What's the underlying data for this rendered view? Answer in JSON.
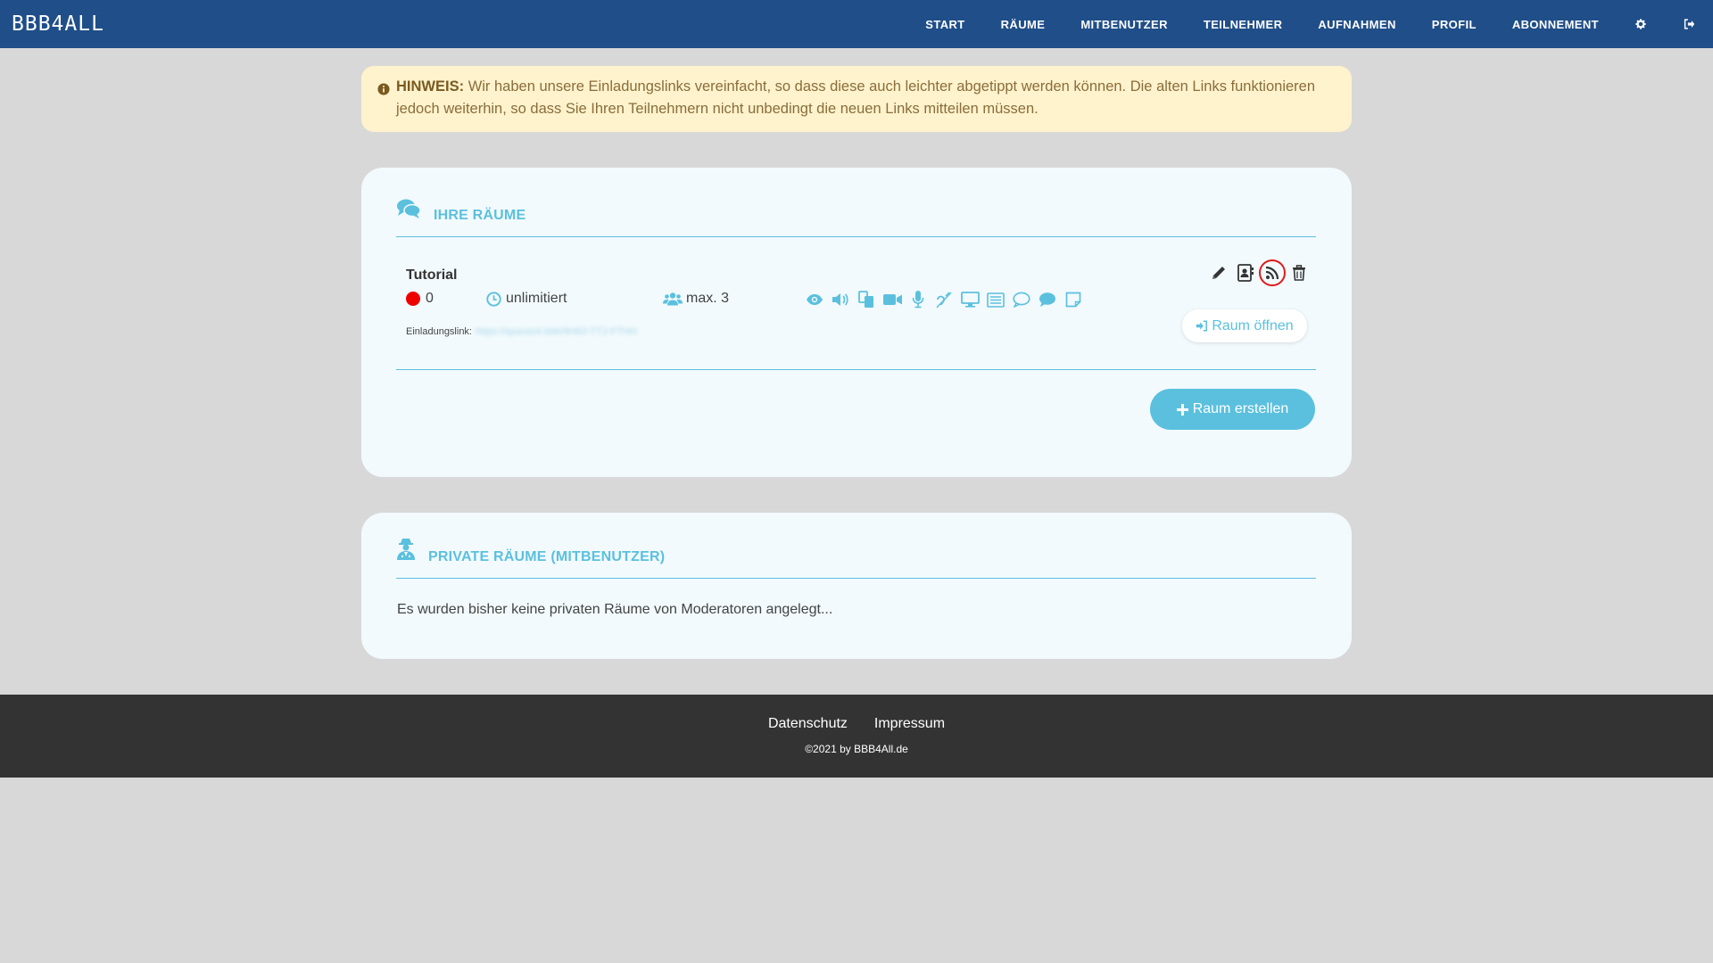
{
  "app": {
    "logo": "BBB4ALL"
  },
  "nav": {
    "items": [
      {
        "label": "START"
      },
      {
        "label": "RÄUME"
      },
      {
        "label": "MITBENUTZER"
      },
      {
        "label": "TEILNEHMER"
      },
      {
        "label": "AUFNAHMEN"
      },
      {
        "label": "PROFIL"
      },
      {
        "label": "ABONNEMENT"
      }
    ],
    "icons": [
      "gear-icon",
      "logout-icon"
    ]
  },
  "alert": {
    "icon": "info-circle-icon",
    "label": "HINWEIS:",
    "text": "Wir haben unsere Einladungslinks vereinfacht, so dass diese auch leichter abgetippt werden können. Die alten Links funktionieren jedoch weiterhin, so dass Sie Ihren Teilnehmern nicht unbedingt die neuen Links mitteilen müssen."
  },
  "my_rooms": {
    "title": "IHRE RÄUME",
    "icon": "comments-icon",
    "rooms": [
      {
        "name": "Tutorial",
        "online_count": "0",
        "duration": "unlimitiert",
        "max_users": "max. 3",
        "invite_label": "Einladungslink:",
        "invite_url": "https://spaces4.bbb/9H83-TT2-FTHH",
        "feature_icons": [
          "eye-icon",
          "volume-icon",
          "copy-icon",
          "video-icon",
          "microphone-icon",
          "deaf-icon",
          "desktop-icon",
          "list-icon",
          "comment-outline-icon",
          "comment-icon",
          "note-icon"
        ],
        "action_icons": [
          "pencil-icon",
          "contact-icon",
          "rss-icon",
          "trash-icon"
        ],
        "open_label": "Raum öffnen"
      }
    ],
    "create_label": "Raum erstellen"
  },
  "private_rooms": {
    "title": "PRIVATE RÄUME (MITBENUTZER)",
    "icon": "user-secret-icon",
    "empty_text": "Es wurden bisher keine privaten Räume von Moderatoren angelegt..."
  },
  "footer": {
    "links": [
      {
        "label": "Datenschutz"
      },
      {
        "label": "Impressum"
      }
    ],
    "copyright": "©2021 by BBB4All.de"
  },
  "colors": {
    "navbar": "#1f4e88",
    "accent": "#5bc0de",
    "alert_bg": "#fff3cd",
    "alert_text": "#8a6d3b",
    "footer": "#333333",
    "highlight_ring": "#e01a1a"
  }
}
